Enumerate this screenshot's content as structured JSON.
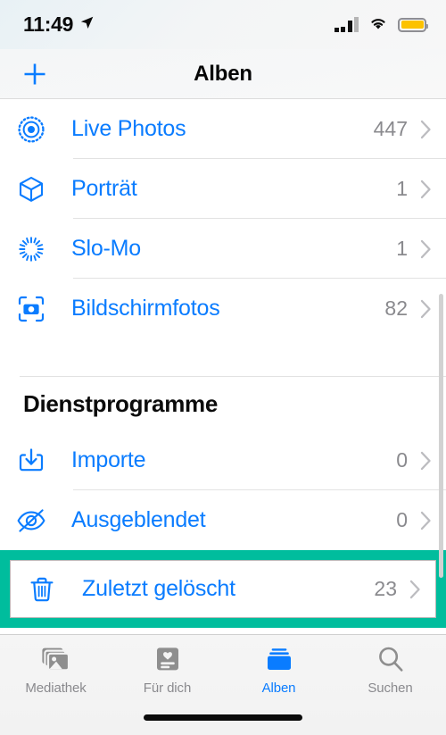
{
  "status_bar": {
    "time": "11:49",
    "location_icon": "location-arrow-icon",
    "cellular_icon": "cellular-signal-icon",
    "wifi_icon": "wifi-icon",
    "battery_icon": "battery-icon",
    "battery_level_percent": 85
  },
  "nav": {
    "add_icon": "plus-icon",
    "title": "Alben"
  },
  "colors": {
    "accent_blue": "#0a7cff",
    "highlight_teal": "#00bd9d",
    "count_gray": "#8a8a8e",
    "battery_yellow": "#fcc200"
  },
  "list": {
    "media_types": [
      {
        "icon": "live-photos-icon",
        "label": "Live Photos",
        "count": "447"
      },
      {
        "icon": "cube-icon",
        "label": "Porträt",
        "count": "1"
      },
      {
        "icon": "slo-mo-icon",
        "label": "Slo-Mo",
        "count": "1"
      },
      {
        "icon": "screenshot-icon",
        "label": "Bildschirmfotos",
        "count": "82"
      }
    ],
    "section_title": "Dienstprogramme",
    "utilities": [
      {
        "icon": "import-icon",
        "label": "Importe",
        "count": "0"
      },
      {
        "icon": "eye-slash-icon",
        "label": "Ausgeblendet",
        "count": "0"
      },
      {
        "icon": "trash-icon",
        "label": "Zuletzt gelöscht",
        "count": "23",
        "highlighted": true
      }
    ],
    "chevron_icon": "chevron-right-icon"
  },
  "tabbar": {
    "tabs": [
      {
        "icon": "photos-library-icon",
        "label": "Mediathek",
        "active": false
      },
      {
        "icon": "for-you-card-icon",
        "label": "Für dich",
        "active": false
      },
      {
        "icon": "albums-icon",
        "label": "Alben",
        "active": true
      },
      {
        "icon": "search-icon",
        "label": "Suchen",
        "active": false
      }
    ],
    "home_indicator": "home-indicator"
  }
}
